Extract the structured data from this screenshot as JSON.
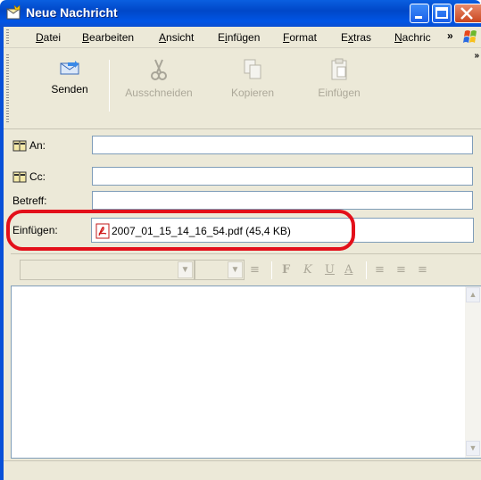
{
  "window": {
    "title": "Neue Nachricht"
  },
  "menu": {
    "items": [
      {
        "label": "Datei",
        "accel": "D",
        "rest": "atei",
        "pre": ""
      },
      {
        "label": "Bearbeiten",
        "accel": "B",
        "rest": "earbeiten",
        "pre": ""
      },
      {
        "label": "Ansicht",
        "accel": "A",
        "rest": "nsicht",
        "pre": ""
      },
      {
        "label": "Einfügen",
        "pre": "E",
        "accel": "i",
        "rest": "nfügen"
      },
      {
        "label": "Format",
        "accel": "F",
        "rest": "ormat",
        "pre": ""
      },
      {
        "label": "Extras",
        "pre": "E",
        "accel": "x",
        "rest": "tras"
      },
      {
        "label": "Nachric",
        "accel": "N",
        "rest": "achric",
        "pre": ""
      }
    ],
    "overflow": "»"
  },
  "toolbar": {
    "send": "Senden",
    "cut": "Ausschneiden",
    "copy": "Kopieren",
    "paste": "Einfügen",
    "overflow": "»"
  },
  "header": {
    "to_label": "An:",
    "cc_label": "Cc:",
    "subject_label": "Betreff:",
    "attach_label": "Einfügen:",
    "to_value": "",
    "cc_value": "",
    "subject_value": ""
  },
  "attachment": {
    "name": "2007_01_15_14_16_54.pdf (45,4 KB)"
  },
  "format_toolbar": {
    "icons": [
      "align-icon",
      "bold-icon",
      "italic-icon",
      "underline-icon",
      "font-color-icon",
      "numbered-list-icon",
      "bullet-list-icon",
      "indent-icon"
    ],
    "bold": "F",
    "italic": "K",
    "underline": "U",
    "color": "A"
  },
  "colors": {
    "titlebar": "#0055e5",
    "frame": "#ece9d8",
    "highlight": "#e3101a",
    "input_border": "#7f9db9"
  }
}
